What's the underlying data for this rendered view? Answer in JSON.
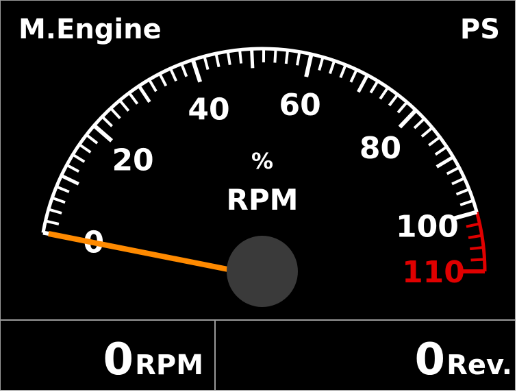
{
  "header": {
    "title": "M.Engine",
    "side": "PS"
  },
  "gauge": {
    "units_top": "%",
    "units_bottom": "RPM",
    "min": 0,
    "max": 110,
    "redline_start": 100,
    "value": 0,
    "labels": [
      {
        "text": "0",
        "value": 0,
        "red": false
      },
      {
        "text": "20",
        "value": 20,
        "red": false
      },
      {
        "text": "40",
        "value": 40,
        "red": false
      },
      {
        "text": "60",
        "value": 60,
        "red": false
      },
      {
        "text": "80",
        "value": 80,
        "red": false
      },
      {
        "text": "100",
        "value": 100,
        "red": false
      },
      {
        "text": "110",
        "value": 110,
        "red": true
      }
    ],
    "colors": {
      "scale": "#ffffff",
      "redline": "#e00000",
      "needle": "#ff8a00",
      "hub": "#3a3a3a",
      "background": "#000000"
    }
  },
  "readouts": {
    "rpm": {
      "value": "0",
      "unit": "RPM"
    },
    "rev": {
      "value": "0",
      "unit": "Rev."
    }
  }
}
